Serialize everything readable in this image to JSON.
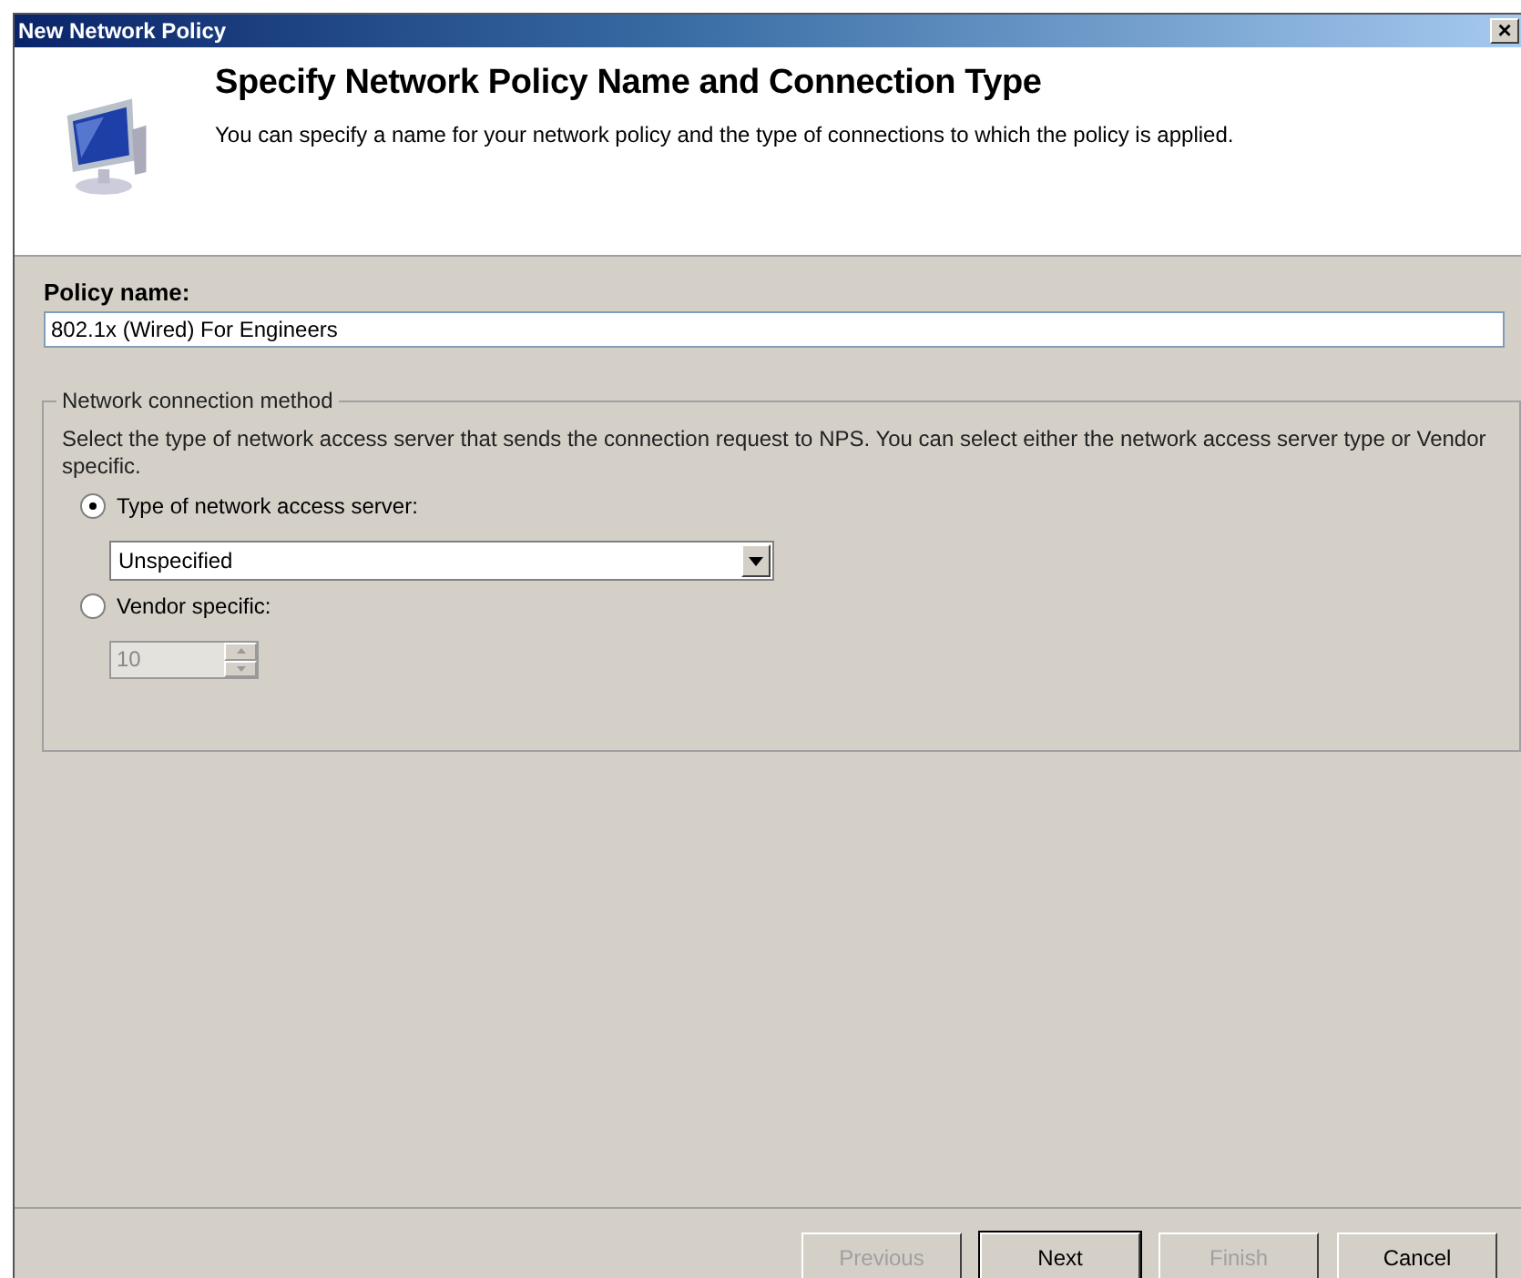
{
  "window": {
    "title": "New Network Policy",
    "close": "×"
  },
  "header": {
    "title": "Specify Network Policy Name and Connection Type",
    "description": "You can specify a name for your network policy and the type of connections to which the policy is applied."
  },
  "policy_name": {
    "label": "Policy name:",
    "value": "802.1x (Wired) For Engineers"
  },
  "connection_method": {
    "legend": "Network connection method",
    "description": "Select the type of network access server that sends the connection request to NPS. You can select either the network access server type or Vendor specific.",
    "options": [
      {
        "label": "Type of network access server:",
        "selected": true,
        "kind": "dropdown",
        "value": "Unspecified",
        "disabled": false
      },
      {
        "label": "Vendor specific:",
        "selected": false,
        "kind": "spinner",
        "value": "10",
        "disabled": true
      }
    ]
  },
  "buttons": [
    {
      "label": "Previous",
      "disabled": true,
      "default": false
    },
    {
      "label": "Next",
      "disabled": false,
      "default": true
    },
    {
      "label": "Finish",
      "disabled": true,
      "default": false
    },
    {
      "label": "Cancel",
      "disabled": false,
      "default": false
    }
  ]
}
